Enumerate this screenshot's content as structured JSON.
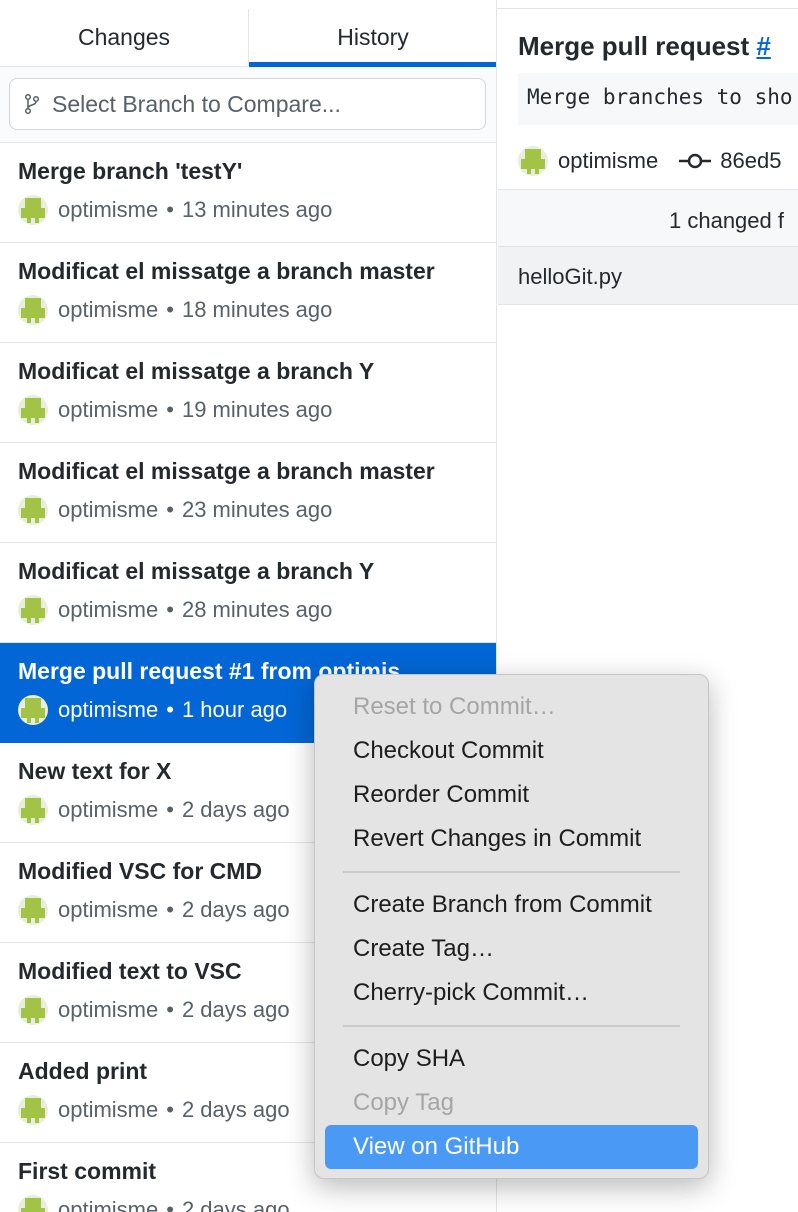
{
  "tabs": [
    {
      "label": "Changes"
    },
    {
      "label": "History"
    }
  ],
  "branch_compare": {
    "placeholder": "Select Branch to Compare..."
  },
  "commits": [
    {
      "title": "Merge branch 'testY'",
      "author": "optimisme",
      "time": "13 minutes ago"
    },
    {
      "title": "Modificat el missatge a branch master",
      "author": "optimisme",
      "time": "18 minutes ago"
    },
    {
      "title": "Modificat el missatge a branch Y",
      "author": "optimisme",
      "time": "19 minutes ago"
    },
    {
      "title": "Modificat el missatge a branch master",
      "author": "optimisme",
      "time": "23 minutes ago"
    },
    {
      "title": "Modificat el missatge a branch Y",
      "author": "optimisme",
      "time": "28 minutes ago"
    },
    {
      "title": "Merge pull request #1 from optimis",
      "author": "optimisme",
      "time": "1 hour ago"
    },
    {
      "title": "New text for X",
      "author": "optimisme",
      "time": "2 days ago"
    },
    {
      "title": "Modified VSC for CMD",
      "author": "optimisme",
      "time": "2 days ago"
    },
    {
      "title": "Modified text to VSC",
      "author": "optimisme",
      "time": "2 days ago"
    },
    {
      "title": "Added print",
      "author": "optimisme",
      "time": "2 days ago"
    },
    {
      "title": "First commit",
      "author": "optimisme",
      "time": "2 days ago"
    }
  ],
  "meta_separator": "•",
  "detail": {
    "title_prefix": "Merge pull request ",
    "title_link": "#",
    "description": "Merge branches to sho",
    "author": "optimisme",
    "sha": "86ed5",
    "changed_files": "1 changed f",
    "file": "helloGit.py"
  },
  "context_menu": {
    "reset": "Reset to Commit…",
    "checkout": "Checkout Commit",
    "reorder": "Reorder Commit",
    "revert": "Revert Changes in Commit",
    "create_branch": "Create Branch from Commit",
    "create_tag": "Create Tag…",
    "cherry_pick": "Cherry-pick Commit…",
    "copy_sha": "Copy SHA",
    "copy_tag": "Copy Tag",
    "view_github": "View on GitHub"
  },
  "colors": {
    "accent": "#0366d6",
    "menu_highlight": "#4a9af5",
    "avatar": "#a3c347"
  }
}
